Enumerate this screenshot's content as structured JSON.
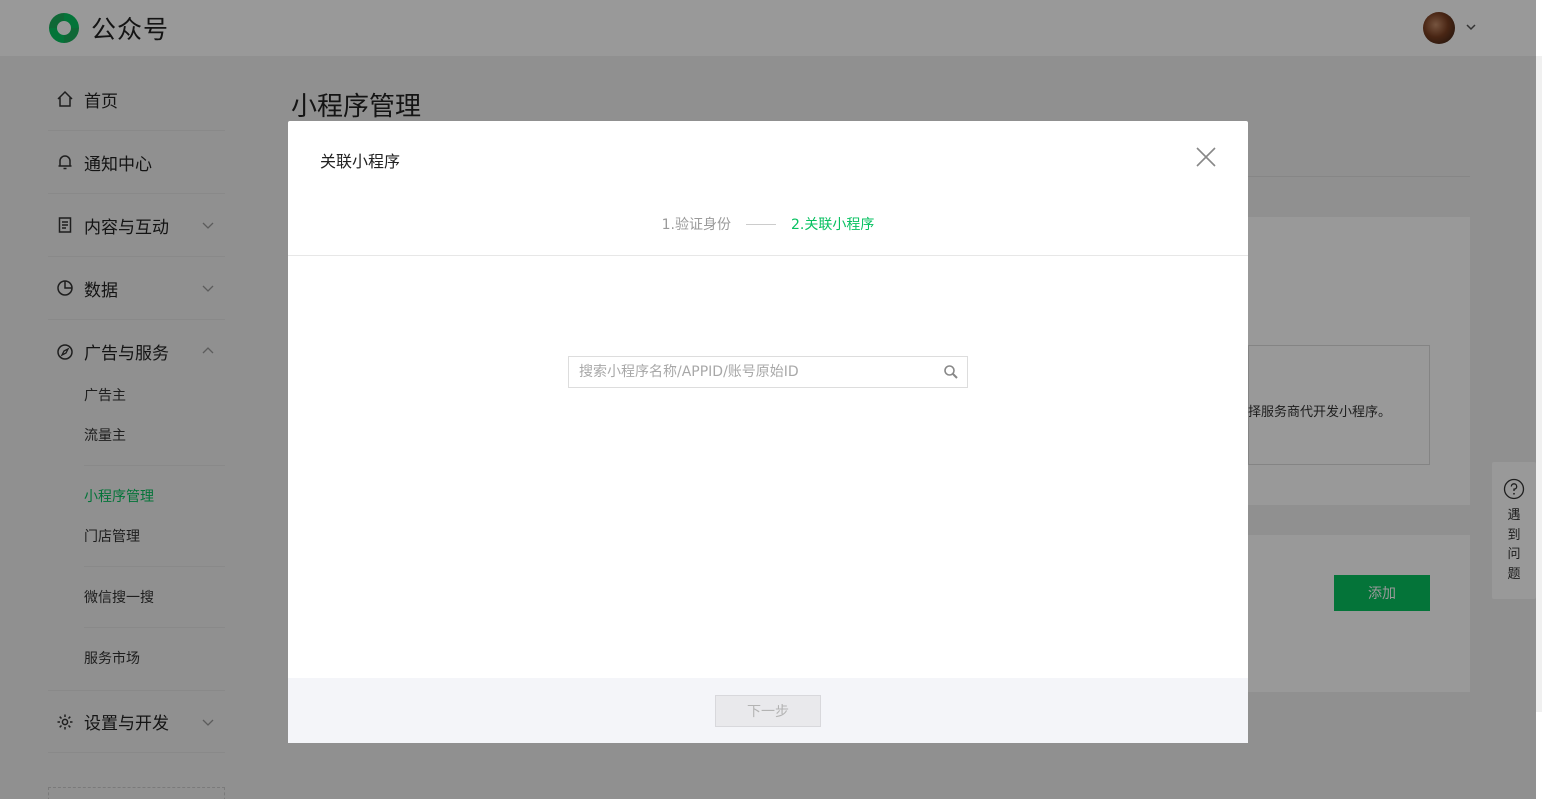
{
  "app": {
    "logo_text": "公众号"
  },
  "colors": {
    "accent": "#07c160",
    "overlay": "rgba(0,0,0,0.40)"
  },
  "sidebar": {
    "groups": [
      {
        "label": "首页",
        "icon": "home-icon"
      },
      {
        "label": "通知中心",
        "icon": "bell-icon"
      },
      {
        "label": "内容与互动",
        "icon": "document-icon",
        "expanded": false
      },
      {
        "label": "数据",
        "icon": "pie-chart-icon",
        "expanded": false
      },
      {
        "label": "广告与服务",
        "icon": "compass-icon",
        "expanded": true
      },
      {
        "label": "设置与开发",
        "icon": "gear-icon",
        "expanded": false
      }
    ],
    "sub_items": [
      "广告主",
      "流量主",
      "小程序管理",
      "门店管理",
      "微信搜一搜",
      "服务市场"
    ],
    "active_item": "小程序管理"
  },
  "main": {
    "title": "小程序管理",
    "card_text": "择服务商代开发小程序。",
    "add_button": "添加"
  },
  "help": {
    "chars": [
      "遇",
      "到",
      "问",
      "题"
    ]
  },
  "modal": {
    "title": "关联小程序",
    "steps": [
      "1.验证身份",
      "2.关联小程序"
    ],
    "current_step": 2,
    "search": {
      "placeholder": "搜索小程序名称/APPID/账号原始ID",
      "value": ""
    },
    "next_button": "下一步",
    "next_enabled": false
  }
}
